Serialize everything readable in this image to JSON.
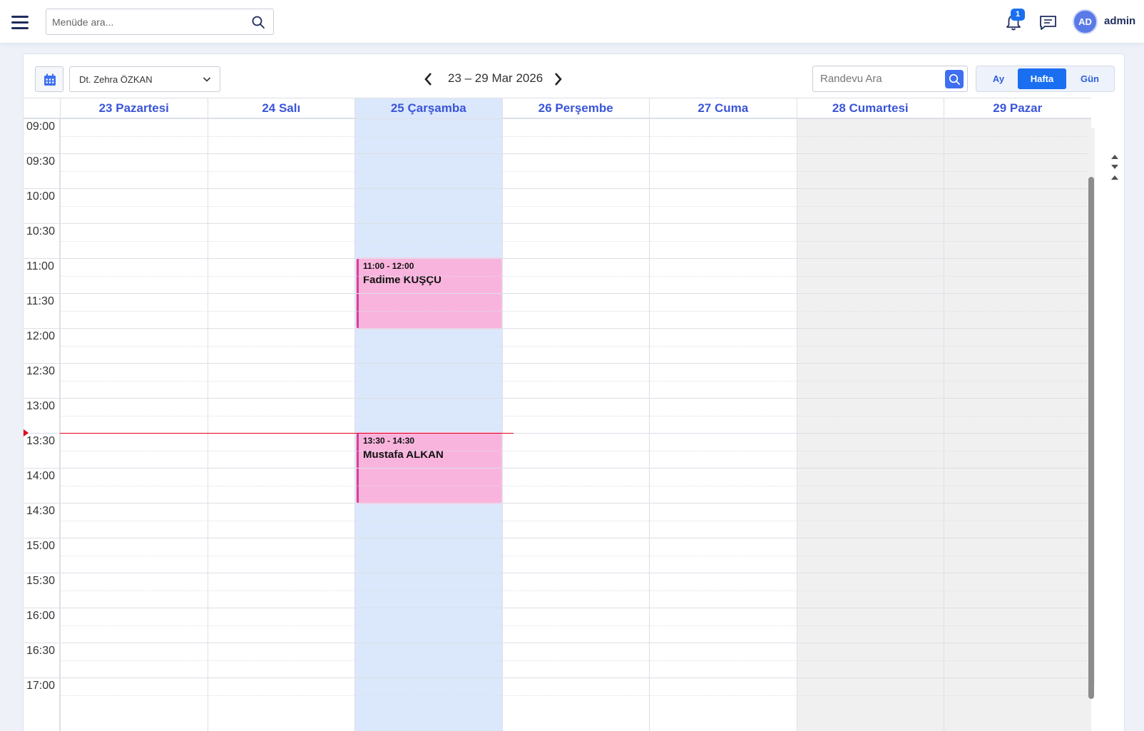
{
  "header": {
    "menu_search_placeholder": "Menüde ara...",
    "notification_count": "1",
    "avatar_initials": "AD",
    "username": "admin"
  },
  "toolbar": {
    "doctor": "Dt. Zehra ÖZKAN",
    "date_range": "23 – 29 Mar 2026",
    "appointment_search_placeholder": "Randevu Ara",
    "views": [
      "Ay",
      "Hafta",
      "Gün"
    ],
    "active_view": "Hafta"
  },
  "days": [
    {
      "label": "23 Pazartesi",
      "type": "weekday"
    },
    {
      "label": "24 Salı",
      "type": "weekday"
    },
    {
      "label": "25 Çarşamba",
      "type": "today"
    },
    {
      "label": "26 Perşembe",
      "type": "weekday"
    },
    {
      "label": "27 Cuma",
      "type": "weekday"
    },
    {
      "label": "28 Cumartesi",
      "type": "weekend"
    },
    {
      "label": "29 Pazar",
      "type": "weekend"
    }
  ],
  "times": [
    "09:00",
    "09:30",
    "10:00",
    "10:30",
    "11:00",
    "11:30",
    "12:00",
    "12:30",
    "13:00",
    "13:30",
    "14:00",
    "14:30",
    "15:00",
    "15:30",
    "16:00",
    "16:30",
    "17:00"
  ],
  "events": [
    {
      "day_index": 2,
      "start": "11:00",
      "time": "11:00 - 12:00",
      "name": "Fadime KUŞÇU"
    },
    {
      "day_index": 2,
      "start": "13:30",
      "time": "13:30 - 14:30",
      "name": "Mustafa ALKAN"
    }
  ],
  "now_time": "13:30",
  "colors": {
    "accent": "#1a6ff0",
    "day_header_text": "#3a55d8",
    "today_bg": "#dbe8fb",
    "weekend_bg": "#f0f0f0",
    "event_bg": "#f9b4dd",
    "event_border": "#d63f96",
    "now_indicator": "#e0001a"
  }
}
